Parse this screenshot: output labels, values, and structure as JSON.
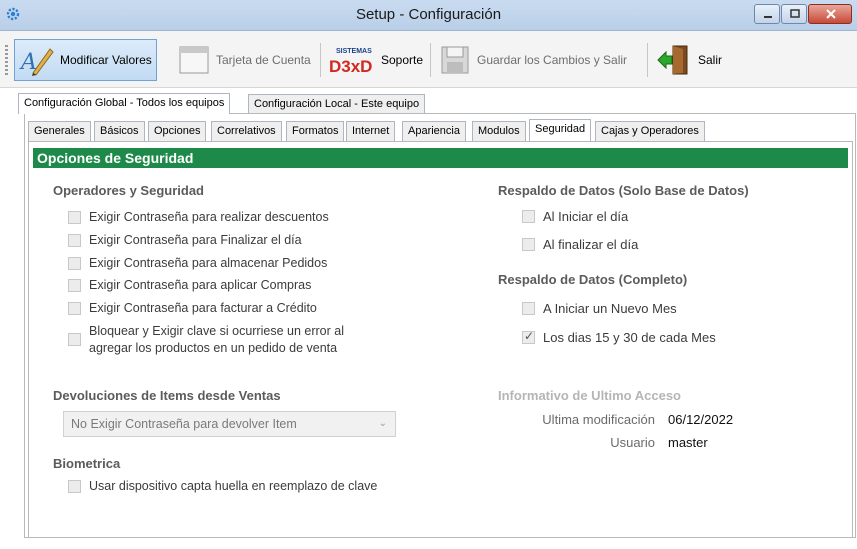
{
  "window": {
    "title": "Setup - Configuración",
    "controls": {
      "minimize": "minimize",
      "maximize": "maximize",
      "close": "close"
    }
  },
  "toolbar": {
    "modify_label": "Modificar Valores",
    "account_card_label": "Tarjeta de Cuenta",
    "support_logo_small": "SISTEMAS",
    "support_logo_big": "D3xD",
    "support_label": "Soporte",
    "save_exit_label": "Guardar los Cambios  y Salir",
    "exit_label": "Salir"
  },
  "outer_tabs": [
    {
      "label": "Configuración Global - Todos los equipos",
      "selected": true
    },
    {
      "label": "Configuración Local - Este equipo",
      "selected": false
    }
  ],
  "inner_tabs": [
    {
      "label": "Generales"
    },
    {
      "label": "Básicos"
    },
    {
      "label": "Opciones"
    },
    {
      "label": "Correlativos"
    },
    {
      "label": "Formatos"
    },
    {
      "label": "Internet"
    },
    {
      "label": "Apariencia"
    },
    {
      "label": "Modulos"
    },
    {
      "label": "Seguridad",
      "selected": true
    },
    {
      "label": "Cajas y Operadores"
    }
  ],
  "section_title": "Opciones de Seguridad",
  "operators": {
    "heading": "Operadores y Seguridad",
    "items": [
      {
        "label": "Exigir Contraseña para realizar descuentos",
        "checked": false
      },
      {
        "label": "Exigir Contraseña para Finalizar el día",
        "checked": false
      },
      {
        "label": "Exigir Contraseña para almacenar Pedidos",
        "checked": false
      },
      {
        "label": "Exigir Contraseña para aplicar Compras",
        "checked": false
      },
      {
        "label": "Exigir Contraseña para facturar a Crédito",
        "checked": false
      },
      {
        "label_line1": "Bloquear y Exigir clave si ocurriese un error al",
        "label_line2": "agregar los productos en un pedido de venta",
        "checked": false
      }
    ]
  },
  "returns": {
    "heading": "Devoluciones de Items desde Ventas",
    "selected_value": "No Exigir Contraseña para devolver Item"
  },
  "biometric": {
    "heading": "Biometrica",
    "item_label": "Usar dispositivo capta huella en reemplazo de clave",
    "checked": false
  },
  "backup_db": {
    "heading": "Respaldo de Datos (Solo Base de Datos)",
    "items": [
      {
        "label": "Al Iniciar el día",
        "checked": false
      },
      {
        "label": "Al finalizar el día",
        "checked": false
      }
    ]
  },
  "backup_full": {
    "heading": "Respaldo de Datos (Completo)",
    "items": [
      {
        "label": "A Iniciar un Nuevo Mes",
        "checked": false
      },
      {
        "label": "Los dias 15 y 30 de cada Mes",
        "checked": true
      }
    ]
  },
  "last_access": {
    "heading": "Informativo de Ultimo Acceso",
    "modified_label": "Ultima modificación",
    "modified_value": "06/12/2022",
    "user_label": "Usuario",
    "user_value": "master"
  },
  "colors": {
    "section_bar": "#1e8a4a",
    "toolbar_active": "#c2dbf3"
  }
}
